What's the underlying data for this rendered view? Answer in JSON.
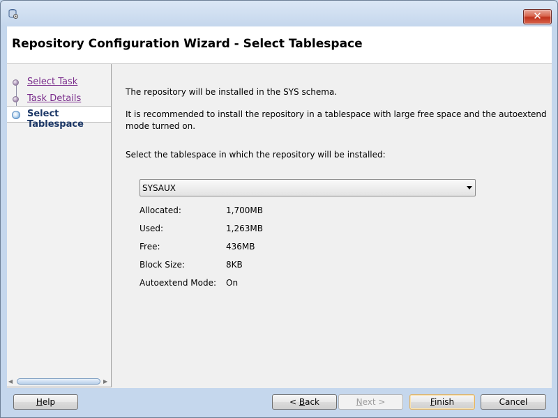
{
  "window": {
    "header_title": "Repository Configuration Wizard - Select Tablespace",
    "close_glyph": "✕"
  },
  "nav": {
    "items": [
      {
        "label": "Select Task",
        "state": "visited"
      },
      {
        "label": "Task Details",
        "state": "visited"
      },
      {
        "label": "Select Tablespace",
        "state": "current"
      }
    ]
  },
  "content": {
    "schema_note": "The repository will be installed in the SYS schema.",
    "recommend_line1": "It is recommended to install the repository in a tablespace with large free space and the autoextend",
    "recommend_line2": "mode turned on.",
    "select_prompt": "Select the tablespace in which the repository will be installed:",
    "tablespace": {
      "selected": "SYSAUX"
    },
    "properties": [
      {
        "label": "Allocated:",
        "value": "1,700MB"
      },
      {
        "label": "Used:",
        "value": "1,263MB"
      },
      {
        "label": "Free:",
        "value": "436MB"
      },
      {
        "label": "Block Size:",
        "value": "8KB"
      },
      {
        "label": "Autoextend Mode:",
        "value": "On"
      }
    ]
  },
  "footer": {
    "help": {
      "mnemonic": "H",
      "rest": "elp"
    },
    "back": {
      "prefix": "< ",
      "mnemonic": "B",
      "rest": "ack"
    },
    "next": {
      "mnemonic": "N",
      "rest": "ext >"
    },
    "finish": {
      "mnemonic": "F",
      "rest": "inish"
    },
    "cancel": "Cancel"
  },
  "colors": {
    "visited_link": "#7a2d8c",
    "current_step": "#1c3766",
    "default_button_border": "#e2b262"
  },
  "icons": {
    "app": "database-wizard-icon",
    "close": "close-icon",
    "dropdown": "chevron-down-icon"
  }
}
